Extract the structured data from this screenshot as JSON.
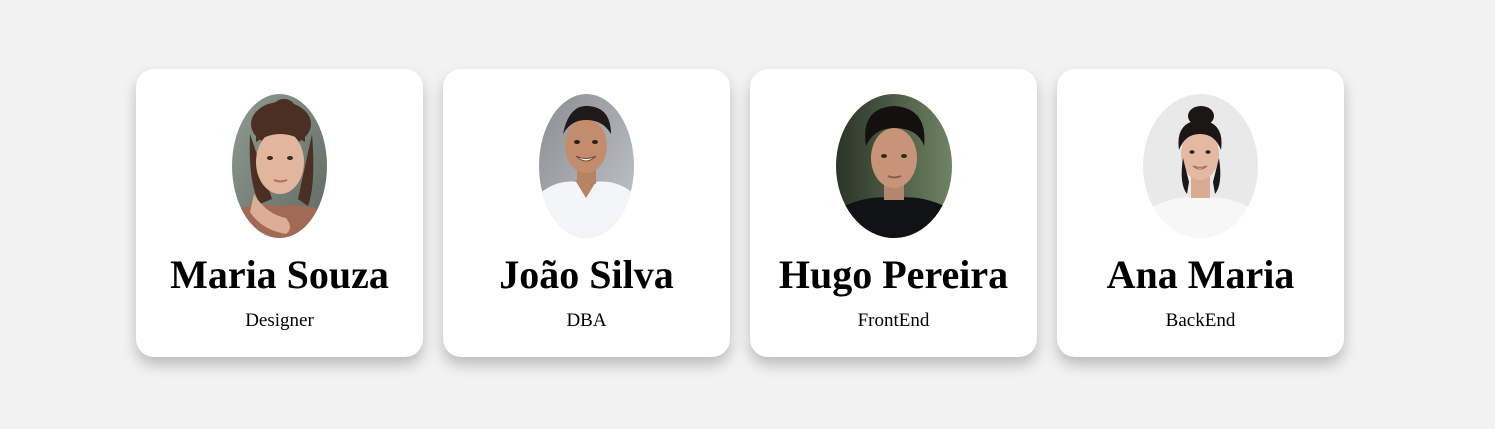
{
  "team": {
    "members": [
      {
        "name": "Maria Souza",
        "role": "Designer"
      },
      {
        "name": "João Silva",
        "role": "DBA"
      },
      {
        "name": "Hugo Pereira",
        "role": "FrontEnd"
      },
      {
        "name": "Ana Maria",
        "role": "BackEnd"
      }
    ]
  },
  "colors": {
    "page_background": "#f2f2f2",
    "card_background": "#ffffff",
    "text": "#000000"
  }
}
